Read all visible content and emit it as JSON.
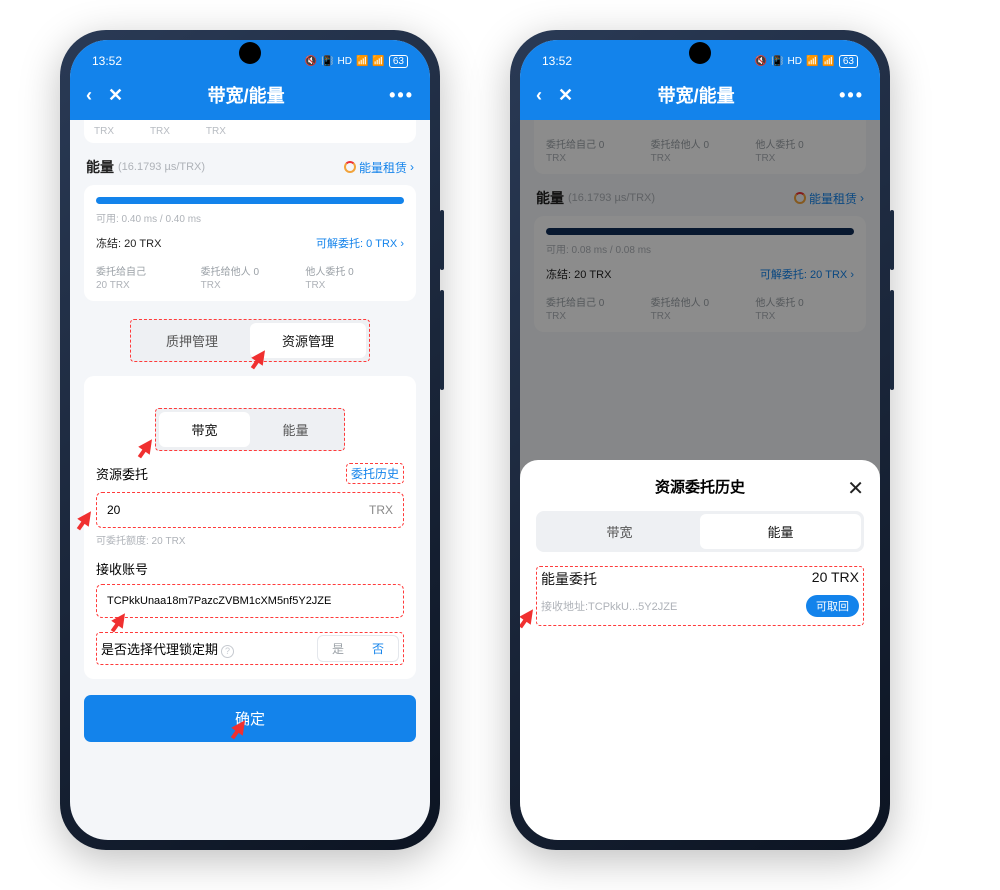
{
  "status": {
    "time": "13:52",
    "battery": "63"
  },
  "header": {
    "title": "带宽/能量"
  },
  "trx_stub": "TRX",
  "energy": {
    "label": "能量",
    "rate": "(16.1793 µs/TRX)",
    "rent_link": "能量租赁"
  },
  "left": {
    "usable": "可用: 0.40 ms / 0.40 ms",
    "freeze": "冻结: 20 TRX",
    "undelegatable": "可解委托: 0 TRX",
    "cells": [
      {
        "t": "委托给自己",
        "s": "20 TRX"
      },
      {
        "t": "委托给他人 0",
        "s": "TRX"
      },
      {
        "t": "他人委托 0",
        "s": "TRX"
      }
    ],
    "tabs": {
      "pledge": "质押管理",
      "resource": "资源管理"
    },
    "subtabs": {
      "bw": "带宽",
      "energy": "能量"
    },
    "delegate_label": "资源委托",
    "history_link": "委托历史",
    "amount": "20",
    "unit": "TRX",
    "quota": "可委托额度: 20 TRX",
    "recv_label": "接收账号",
    "recv_addr": "TCPkkUnaa18m7PazcZVBM1cXM5nf5Y2JZE",
    "lock_q": "是否选择代理锁定期",
    "yes": "是",
    "no": "否",
    "confirm": "确定"
  },
  "right": {
    "topcell": [
      {
        "t": "委托给自己 0",
        "s": "TRX"
      },
      {
        "t": "委托给他人 0",
        "s": "TRX"
      },
      {
        "t": "他人委托 0",
        "s": "TRX"
      }
    ],
    "usable": "可用: 0.08 ms / 0.08 ms",
    "freeze": "冻结: 20 TRX",
    "undelegatable": "可解委托: 20 TRX",
    "cells": [
      {
        "t": "委托给自己 0",
        "s": "TRX"
      },
      {
        "t": "委托给他人 0",
        "s": "TRX"
      },
      {
        "t": "他人委托 0",
        "s": "TRX"
      }
    ],
    "sheet_title": "资源委托历史",
    "tabs": {
      "bw": "带宽",
      "energy": "能量"
    },
    "row": {
      "name": "能量委托",
      "amount": "20 TRX",
      "addr": "接收地址:TCPkkU...5Y2JZE",
      "pill": "可取回"
    }
  }
}
